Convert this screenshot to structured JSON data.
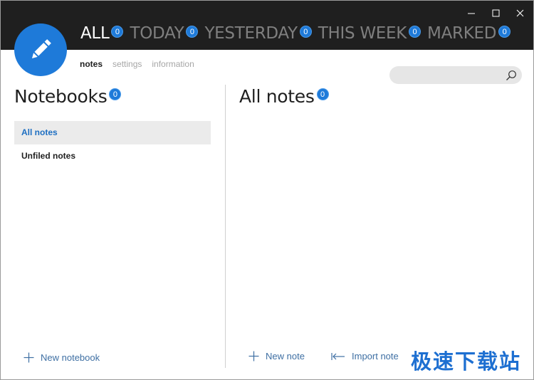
{
  "filters": [
    {
      "label": "ALL",
      "count": "0",
      "active": true
    },
    {
      "label": "TODAY",
      "count": "0",
      "active": false
    },
    {
      "label": "YESTERDAY",
      "count": "0",
      "active": false
    },
    {
      "label": "THIS WEEK",
      "count": "0",
      "active": false
    },
    {
      "label": "MARKED",
      "count": "0",
      "active": false
    }
  ],
  "subtabs": [
    {
      "label": "notes",
      "active": true
    },
    {
      "label": "settings",
      "active": false
    },
    {
      "label": "information",
      "active": false
    }
  ],
  "search": {
    "value": "",
    "placeholder": ""
  },
  "notebooks": {
    "title": "Notebooks",
    "count": "0",
    "items": [
      {
        "label": "All notes",
        "selected": true
      },
      {
        "label": "Unfiled notes",
        "selected": false
      }
    ],
    "new_label": "New notebook"
  },
  "notes": {
    "title": "All notes",
    "count": "0",
    "new_label": "New note",
    "import_label": "Import note"
  },
  "watermark": "极速下载站",
  "icons": {
    "logo": "pencil-icon",
    "search": "search-icon",
    "add": "plus-icon",
    "import": "import-arrow-icon",
    "minimize": "minimize-icon",
    "maximize": "maximize-icon",
    "close": "close-icon"
  },
  "colors": {
    "accent": "#1e7ad9",
    "topbar": "#1f1f1f",
    "link": "#3e6fa3",
    "selected_text": "#1e6fc2",
    "watermark": "#1d6fd1"
  }
}
